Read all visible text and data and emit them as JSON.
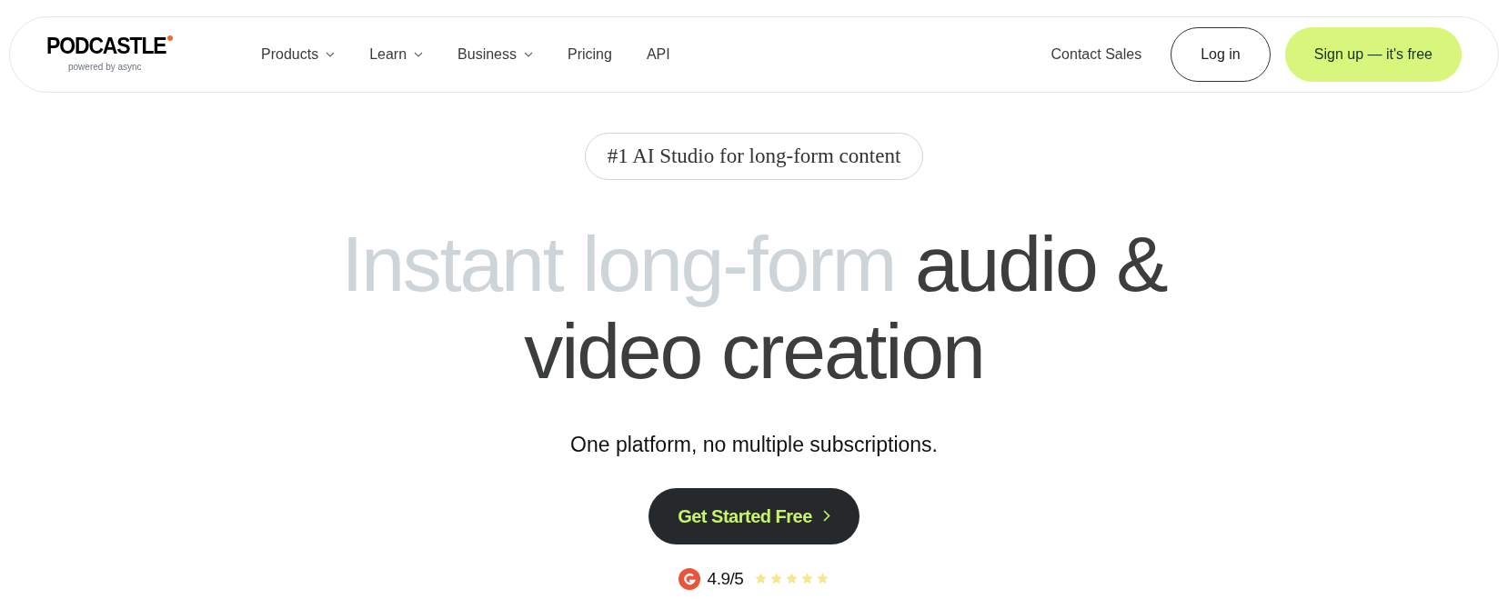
{
  "logo": {
    "name": "PODCASTLE",
    "tagline": "powered by async"
  },
  "nav": [
    {
      "label": "Products",
      "dropdown": true
    },
    {
      "label": "Learn",
      "dropdown": true
    },
    {
      "label": "Business",
      "dropdown": true
    },
    {
      "label": "Pricing",
      "dropdown": false
    },
    {
      "label": "API",
      "dropdown": false
    }
  ],
  "contact": "Contact Sales",
  "login": "Log in",
  "signup": "Sign up — it's free",
  "badge": "#1 AI Studio for long-form content",
  "headline": [
    {
      "text": "Instant long-form ",
      "muted": true
    },
    {
      "text": "audio & video creation",
      "muted": false
    }
  ],
  "subtitle": "One platform, no multiple subscriptions.",
  "cta": "Get Started Free",
  "rating": {
    "score": "4.9/5",
    "stars": 5
  }
}
